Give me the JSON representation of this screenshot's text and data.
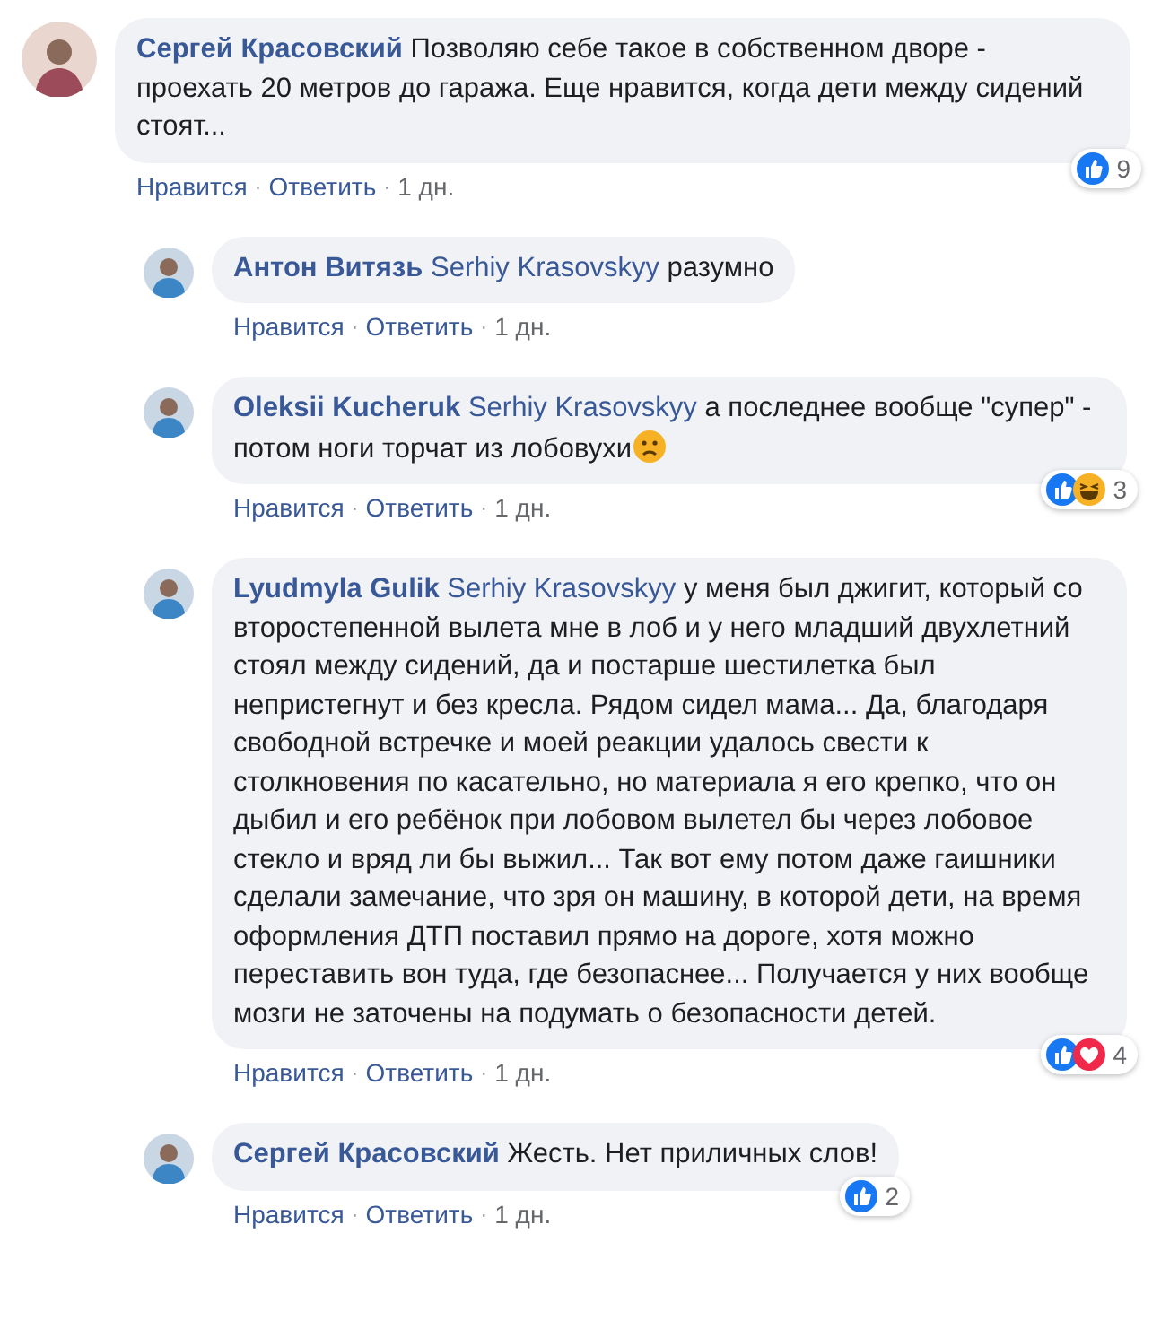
{
  "comments": [
    {
      "author": "Сергей Красовский",
      "text": "Позволяю себе такое в собственном дворе - проехать 20 метров до гаража. Еще нравится, когда дети между сидений стоят...",
      "reactions": {
        "icons": [
          {
            "kind": "like"
          }
        ],
        "count": "9"
      },
      "actions": [
        {
          "kind": "link",
          "text": "Нравится"
        },
        {
          "kind": "separator",
          "text": "·"
        },
        {
          "kind": "link",
          "text": "Ответить"
        },
        {
          "kind": "separator",
          "text": "·"
        },
        {
          "kind": "time",
          "text": "1 дн."
        }
      ],
      "children": [
        {
          "author": "Антон Витязь",
          "mention": "Serhiy Krasovskyy",
          "text": "разумно",
          "actions": [
            {
              "kind": "link",
              "text": "Нравится"
            },
            {
              "kind": "separator",
              "text": "·"
            },
            {
              "kind": "link",
              "text": "Ответить"
            },
            {
              "kind": "separator",
              "text": "·"
            },
            {
              "kind": "time",
              "text": "1 дн."
            }
          ]
        },
        {
          "author": "Oleksii Kucheruk",
          "mention": "Serhiy Krasovskyy",
          "text": "а последнее вообще \"супер\" - потом ноги торчат из лобовухи",
          "emoji": {
            "kind": "sad"
          },
          "reactions": {
            "icons": [
              {
                "kind": "like"
              },
              {
                "kind": "haha"
              }
            ],
            "count": "3"
          },
          "actions": [
            {
              "kind": "link",
              "text": "Нравится"
            },
            {
              "kind": "separator",
              "text": "·"
            },
            {
              "kind": "link",
              "text": "Ответить"
            },
            {
              "kind": "separator",
              "text": "·"
            },
            {
              "kind": "time",
              "text": "1 дн."
            }
          ]
        },
        {
          "author": "Lyudmyla Gulik",
          "mention": "Serhiy Krasovskyy",
          "text": "у меня был джигит, который со второстепенной вылета мне в лоб и у него младший двухлетний стоял между сидений, да и постарше шестилетка был непристегнут и без кресла. Рядом сидел мама... Да, благодаря свободной встречке и моей реакции удалось свести к столкновения по касательно, но материала я его крепко, что он дыбил и его ребёнок при лобовом вылетел бы через лобовое стекло и вряд ли бы выжил... Так вот ему потом даже гаишники сделали замечание, что зря он машину, в которой дети, на время оформления ДТП поставил прямо на дороге, хотя можно переставить вон туда, где безопаснее... Получается у них вообще мозги не заточены на подумать о безопасности детей.",
          "reactions": {
            "icons": [
              {
                "kind": "like"
              },
              {
                "kind": "love"
              }
            ],
            "count": "4"
          },
          "actions": [
            {
              "kind": "link",
              "text": "Нравится"
            },
            {
              "kind": "separator",
              "text": "·"
            },
            {
              "kind": "link",
              "text": "Ответить"
            },
            {
              "kind": "separator",
              "text": "·"
            },
            {
              "kind": "time",
              "text": "1 дн."
            }
          ]
        },
        {
          "author": "Сергей Красовский",
          "text": "Жесть. Нет приличных слов!",
          "reactions": {
            "icons": [
              {
                "kind": "like"
              }
            ],
            "count": "2"
          },
          "actions": [
            {
              "kind": "link",
              "text": "Нравится"
            },
            {
              "kind": "separator",
              "text": "·"
            },
            {
              "kind": "link",
              "text": "Ответить"
            },
            {
              "kind": "separator",
              "text": "·"
            },
            {
              "kind": "time",
              "text": "1 дн."
            }
          ]
        }
      ]
    }
  ]
}
